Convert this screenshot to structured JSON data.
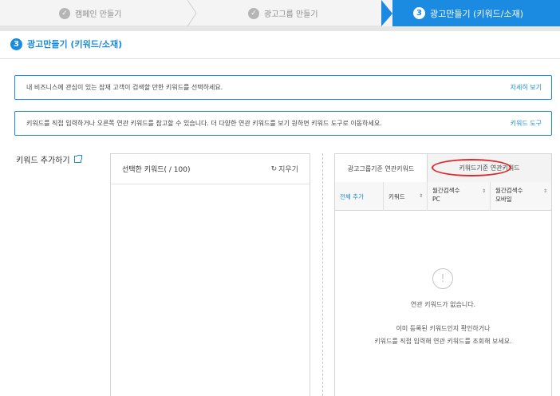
{
  "stepper": {
    "step1": "캠페인 만들기",
    "step2": "광고그룹 만들기",
    "step3_num": "3",
    "step3": "광고만들기 (키워드/소재)",
    "done_glyph": "✓"
  },
  "heading": {
    "num": "3",
    "title": "광고만들기 (키워드/소재)"
  },
  "info1": {
    "text": "내 비즈니스에 관심이 있는 잠재 고객이 검색할 만한 키워드를 선택하세요.",
    "link": "자세히 보기"
  },
  "info2": {
    "text": "키워드를 직접 입력하거나 오른쪽 연관 키워드를 참고할 수 있습니다. 더 다양한 연관 키워드를 보기 원하면 키워드 도구로 이동하세요.",
    "link": "키워드 도구"
  },
  "keyword_add": {
    "label": "키워드 추가하기"
  },
  "selected": {
    "title": "선택한 키워드(   / 100)",
    "reset_icon": "↻",
    "reset": "지우기"
  },
  "related": {
    "tab_group": "광고그룹기준 연관키워드",
    "tab_keyword": "키워드기준 연관키워드",
    "headers": {
      "add_all": "전체 추가",
      "keyword": "키워드",
      "pc_line1": "월간검색수",
      "pc_line2": "PC",
      "mobile_line1": "월간검색수",
      "mobile_line2": "모바일",
      "sort_glyph": "⇕"
    },
    "empty_icon": "!",
    "empty_msg": "연관 키워드가 없습니다.",
    "empty_hint1": "이미 등록된 키워드인지 확인하거나",
    "empty_hint2": "키워드를 직접 입력해 연관 키워드를 조회해 보세요."
  },
  "colors": {
    "accent": "#1a8be0",
    "highlight": "#e0262b"
  }
}
